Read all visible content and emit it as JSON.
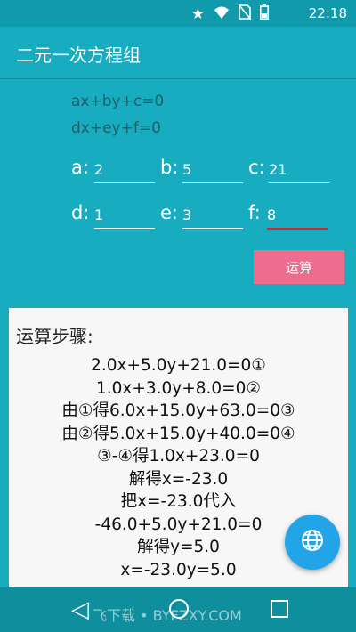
{
  "status_bar": {
    "time": "22:18",
    "icons": [
      "star-icon",
      "wifi-icon",
      "no-sim-icon",
      "battery-icon"
    ]
  },
  "app": {
    "title": "二元一次方程组"
  },
  "equations": {
    "line1": "ax+by+c=0",
    "line2": "dx+ey+f=0"
  },
  "params": [
    {
      "label": "a:",
      "value": "2"
    },
    {
      "label": "b:",
      "value": "5"
    },
    {
      "label": "c:",
      "value": "21"
    },
    {
      "label": "d:",
      "value": "1"
    },
    {
      "label": "e:",
      "value": "3"
    },
    {
      "label": "f:",
      "value": "8"
    }
  ],
  "calc_button": {
    "label": "运算"
  },
  "steps": {
    "title": "运算步骤:",
    "lines": [
      "2.0x+5.0y+21.0=0①",
      "1.0x+3.0y+8.0=0②",
      "由①得6.0x+15.0y+63.0=0③",
      "由②得5.0x+15.0y+40.0=0④",
      "③-④得1.0x+23.0=0",
      "解得x=-23.0",
      "把x=-23.0代入",
      "-46.0+5.0y+21.0=0",
      "解得y=5.0",
      "x=-23.0y=5.0"
    ]
  },
  "fab": {
    "icon": "globe-icon"
  },
  "nav": {
    "watermark": "飞下载 • BYFZXY.COM"
  },
  "colors": {
    "primary": "#17acc0",
    "status_bar": "#109aab",
    "accent": "#ee6d8f",
    "fab": "#21a5e8",
    "error_underline": "#d9242e"
  }
}
